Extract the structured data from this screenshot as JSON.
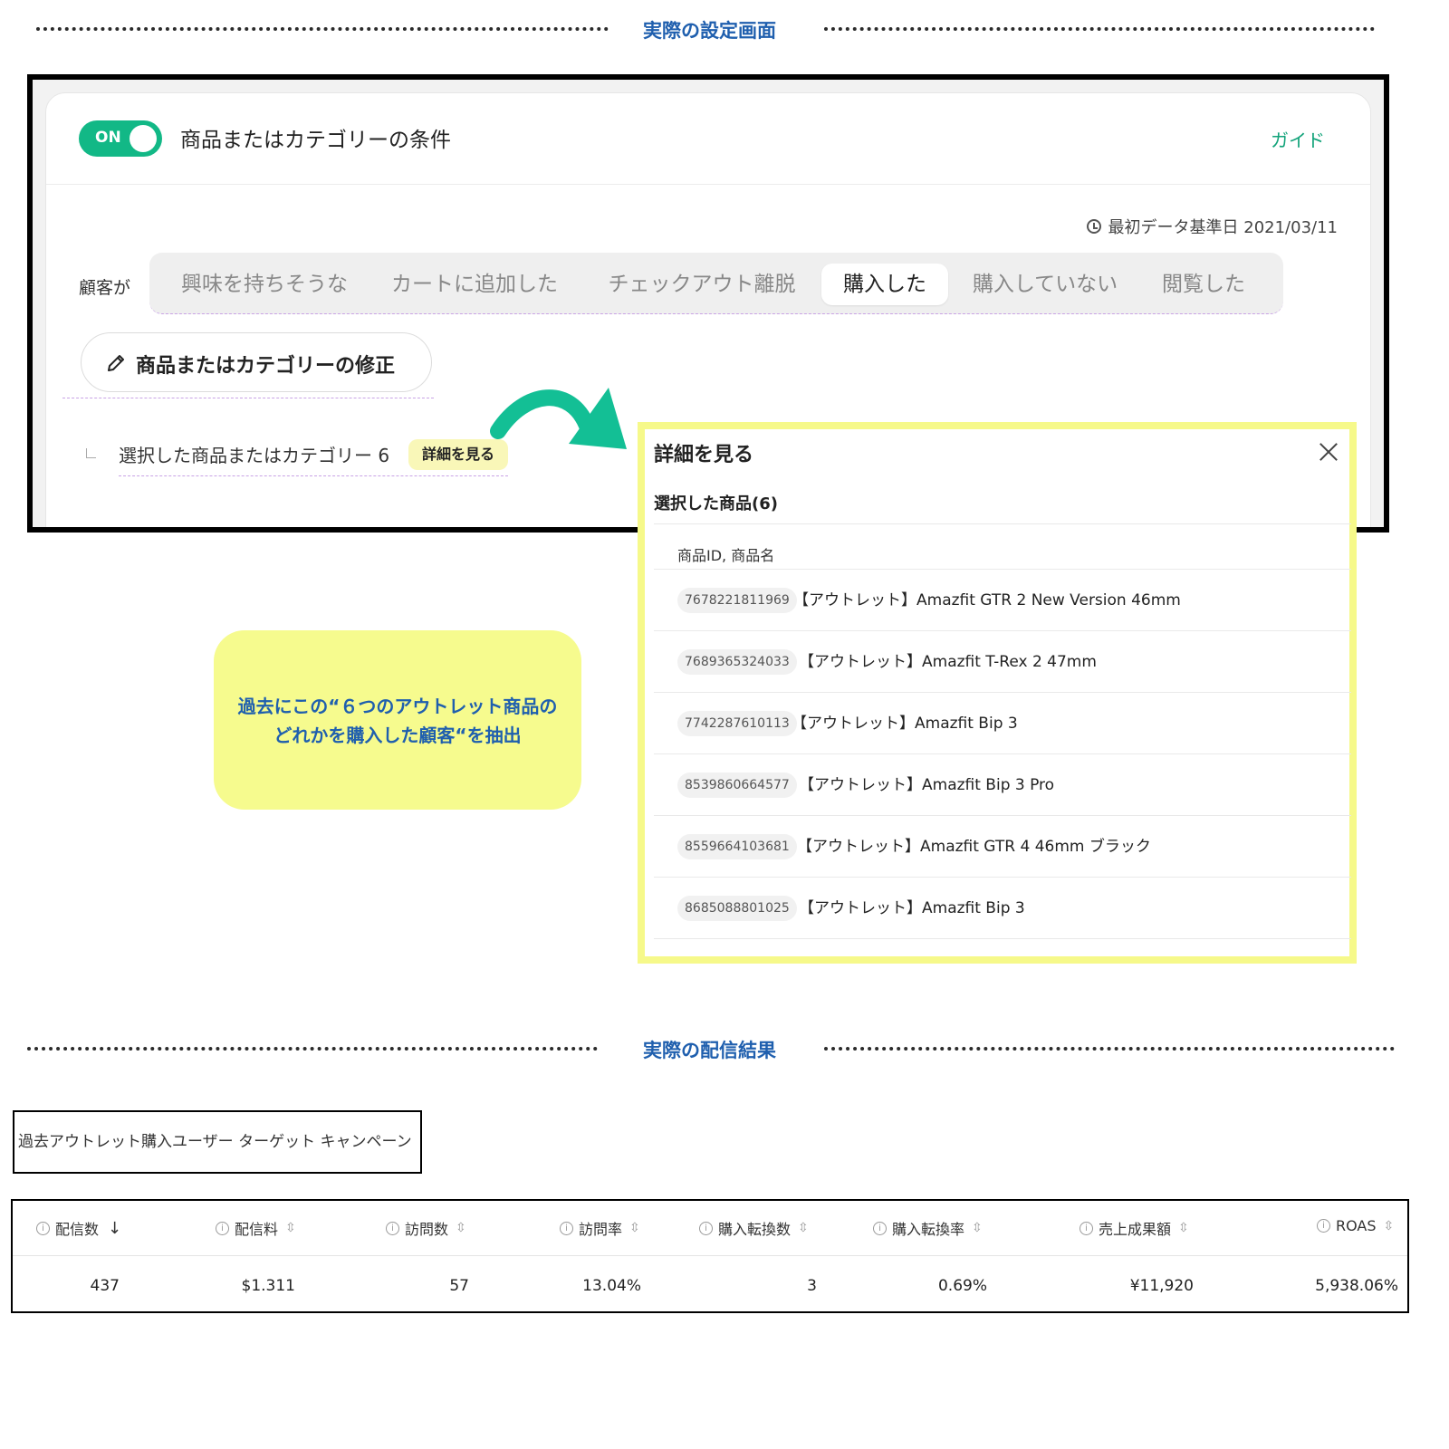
{
  "sections": {
    "settings_title": "実際の設定画面",
    "results_title": "実際の配信結果"
  },
  "card": {
    "toggle_label": "ON",
    "title": "商品またはカテゴリーの条件",
    "guide_link": "ガイド",
    "base_date": "最初データ基準日 2021/03/11",
    "customer_label": "顧客が",
    "tabs": [
      {
        "label": "興味を持ちそうな",
        "active": false
      },
      {
        "label": "カートに追加した",
        "active": false
      },
      {
        "label": "チェックアウト離脱",
        "active": false
      },
      {
        "label": "購入した",
        "active": true
      },
      {
        "label": "購入していない",
        "active": false
      },
      {
        "label": "閲覧した",
        "active": false
      }
    ],
    "edit_button": "商品またはカテゴリーの修正",
    "selected_text": "選択した商品またはカテゴリー 6",
    "detail_chip": "詳細を見る"
  },
  "modal": {
    "title": "詳細を見る",
    "subtitle": "選択した商品(6)",
    "column_header": "商品ID, 商品名",
    "items": [
      {
        "id": "7678221811969",
        "name": "【アウトレット】Amazfit GTR 2 New Version 46mm"
      },
      {
        "id": "7689365324033",
        "name": "【アウトレット】Amazfit T-Rex 2 47mm"
      },
      {
        "id": "7742287610113",
        "name": "【アウトレット】Amazfit Bip 3"
      },
      {
        "id": "8539860664577",
        "name": "【アウトレット】Amazfit Bip 3 Pro"
      },
      {
        "id": "8559664103681",
        "name": "【アウトレット】Amazfit GTR 4 46mm ブラック"
      },
      {
        "id": "8685088801025",
        "name": "【アウトレット】Amazfit Bip 3"
      }
    ]
  },
  "note": {
    "line1": "過去にこの“６つのアウトレット商品の",
    "line2": "どれかを購入した顧客“を抽出"
  },
  "campaign_name": "過去アウトレット購入ユーザー ターゲット キャンペーン",
  "results": {
    "headers": [
      "配信数",
      "配信料",
      "訪問数",
      "訪問率",
      "購入転換数",
      "購入転換率",
      "売上成果額",
      "ROAS"
    ],
    "values": [
      "437",
      "$1.311",
      "57",
      "13.04%",
      "3",
      "0.69%",
      "¥11,920",
      "5,938.06%"
    ]
  },
  "colors": {
    "accent_green": "#12b886",
    "highlight_yellow": "#f6f98a",
    "section_blue": "#1f5fae"
  }
}
